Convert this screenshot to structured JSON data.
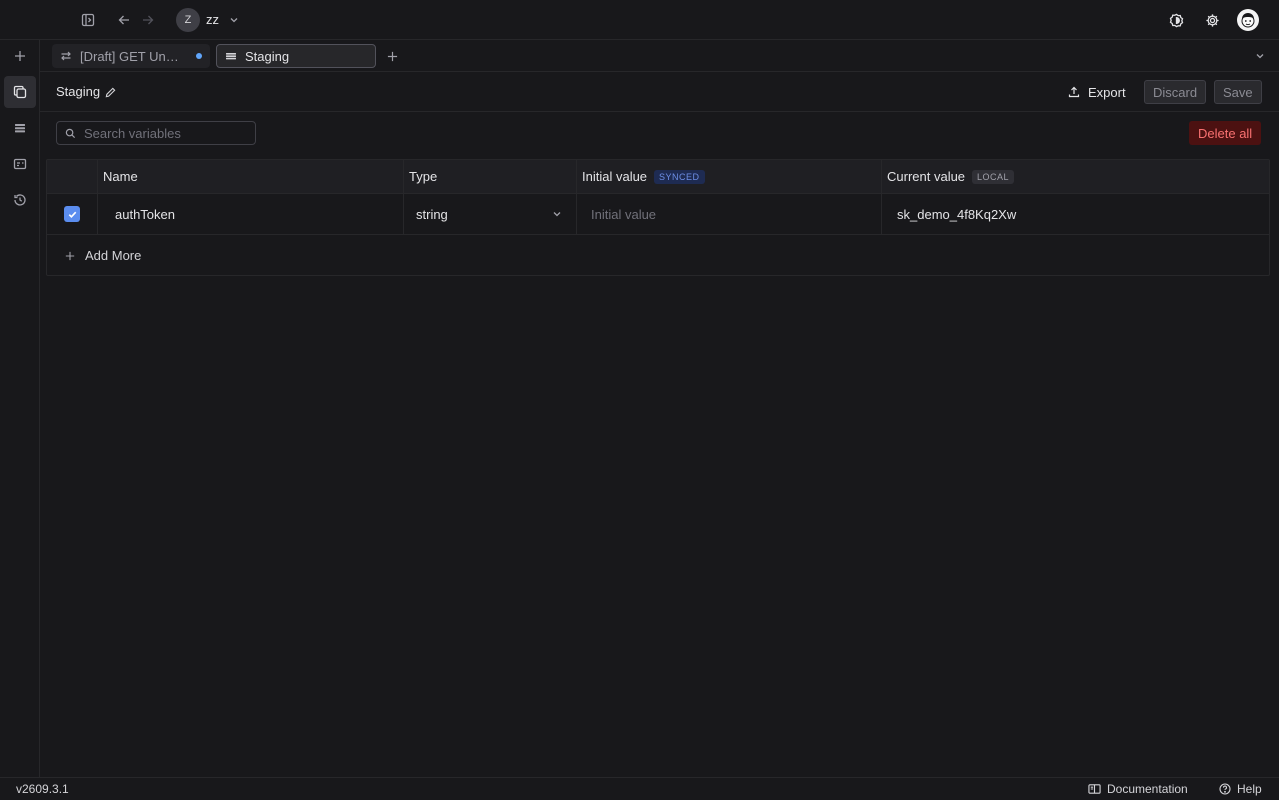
{
  "workspace": {
    "initial": "Z",
    "name": "zz"
  },
  "tabs": [
    {
      "label": "[Draft] GET Untitled",
      "display": "[Draft] GET Unt...",
      "unsaved": true
    },
    {
      "label": "Staging",
      "active": true
    }
  ],
  "environment": {
    "title": "Staging",
    "export_label": "Export",
    "discard_label": "Discard",
    "save_label": "Save"
  },
  "search": {
    "placeholder": "Search variables",
    "value": ""
  },
  "delete_all_label": "Delete all",
  "table": {
    "columns": {
      "name": "Name",
      "type": "Type",
      "initial": "Initial value",
      "initial_badge": "SYNCED",
      "current": "Current value",
      "current_badge": "LOCAL"
    },
    "rows": [
      {
        "enabled": true,
        "name": "authToken",
        "type": "string",
        "initial_value": "",
        "initial_placeholder": "Initial value",
        "current_value": "sk_demo_4f8Kq2Xw"
      }
    ],
    "add_more_label": "Add More"
  },
  "footer": {
    "version": "v2609.3.1",
    "documentation_label": "Documentation",
    "help_label": "Help"
  },
  "colors": {
    "background": "#18181b",
    "accent": "#5b8def",
    "danger": "#f87171",
    "unsaved_dot": "#60a5fa"
  }
}
